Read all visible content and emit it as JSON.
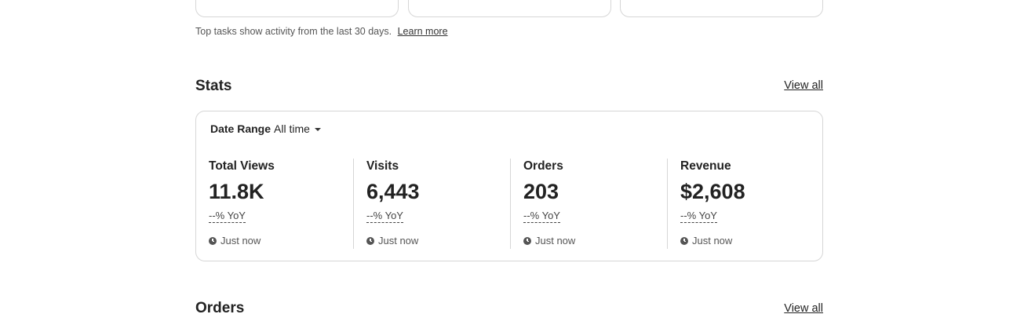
{
  "top_tasks": {
    "note": "Top tasks show activity from the last 30 days.",
    "learn_more": "Learn more"
  },
  "stats": {
    "title": "Stats",
    "view_all": "View all",
    "date_range_label": "Date Range",
    "date_range_value": "All time",
    "metrics": [
      {
        "label": "Total Views",
        "value": "11.8K",
        "yoy": "--% YoY",
        "updated": "Just now"
      },
      {
        "label": "Visits",
        "value": "6,443",
        "yoy": "--% YoY",
        "updated": "Just now"
      },
      {
        "label": "Orders",
        "value": "203",
        "yoy": "--% YoY",
        "updated": "Just now"
      },
      {
        "label": "Revenue",
        "value": "$2,608",
        "yoy": "--% YoY",
        "updated": "Just now"
      }
    ]
  },
  "orders": {
    "title": "Orders",
    "view_all": "View all"
  },
  "icons": {
    "timestamp": "clock-icon",
    "dropdown": "chevron-down-icon"
  }
}
